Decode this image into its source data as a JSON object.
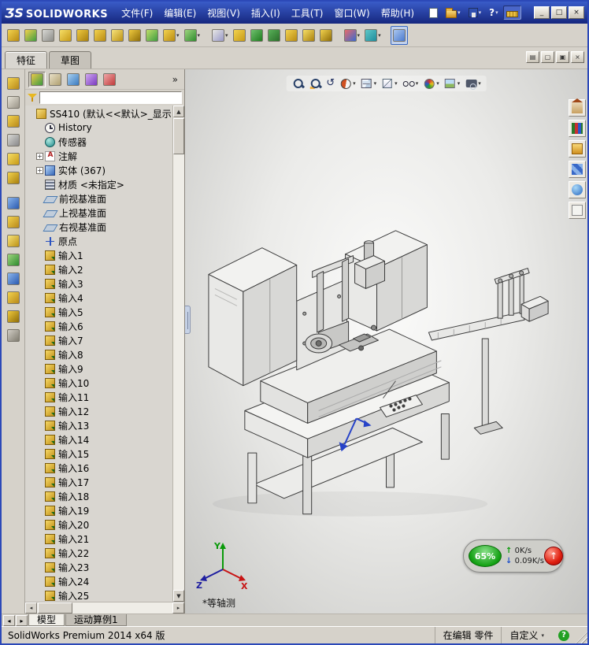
{
  "titlebar": {
    "logo_mark": "ƷS",
    "logo_text": "SOLIDWORKS",
    "menus": [
      "文件(F)",
      "编辑(E)",
      "视图(V)",
      "插入(I)",
      "工具(T)",
      "窗口(W)",
      "帮助(H)"
    ],
    "quick_icons": [
      {
        "name": "new-document-icon",
        "cls": "ic-page"
      },
      {
        "name": "open-document-icon",
        "cls": "ic-folder",
        "dd": true
      },
      {
        "name": "save-icon",
        "cls": "ic-disk",
        "dd": true
      },
      {
        "name": "help-icon",
        "glyph": "?",
        "dd": true
      },
      {
        "name": "measure-tool-icon",
        "cls": "ic-meas",
        "pressed": true
      }
    ],
    "window_buttons": [
      {
        "name": "minimize-button",
        "glyph": "_"
      },
      {
        "name": "maximize-button",
        "glyph": "□"
      },
      {
        "name": "close-button",
        "glyph": "×"
      }
    ]
  },
  "toolbar": {
    "icons": [
      {
        "name": "screen-capture-icon",
        "c1": "#f2d24e",
        "c2": "#b98b12"
      },
      {
        "name": "move-tool-icon",
        "c1": "#f2d24e",
        "c2": "#3f9c3f"
      },
      {
        "name": "selection-tool-icon",
        "c1": "#d8d8d4",
        "c2": "#8c8c88"
      },
      {
        "name": "alarm-tool-icon",
        "c1": "#f6de66",
        "c2": "#c79a16"
      },
      {
        "name": "sheet-tool-icon",
        "c1": "#eec83e",
        "c2": "#a87f0e"
      },
      {
        "name": "box-tool-icon",
        "c1": "#f2d24e",
        "c2": "#b98b12"
      },
      {
        "name": "folder-tool-icon",
        "c1": "#f6e27a",
        "c2": "#bd9214"
      },
      {
        "name": "export-tool-icon",
        "c1": "#eec83e",
        "c2": "#8f6d08"
      },
      {
        "name": "table-tool-icon",
        "c1": "#bede6a",
        "c2": "#3f9c3f"
      },
      {
        "name": "list-tool-icon",
        "c1": "#f2d24e",
        "c2": "#b98b12",
        "dd": true
      },
      {
        "name": "bom-tool-icon",
        "c1": "#9ed47e",
        "c2": "#2e8c2e",
        "dd": true
      },
      {
        "name": "pattern-tool-icon",
        "c1": "#e8e8e4",
        "c2": "#9898c8",
        "dd": true,
        "gap": true
      },
      {
        "name": "arrow-tool-icon",
        "c1": "#f2d24e",
        "c2": "#c79a16"
      },
      {
        "name": "flag-tool-icon",
        "c1": "#6ec06e",
        "c2": "#1e7c1e"
      },
      {
        "name": "library-tool-icon",
        "c1": "#58b058",
        "c2": "#2a6e2a"
      },
      {
        "name": "cylinder-tool-icon",
        "c1": "#f2d24e",
        "c2": "#b98b12"
      },
      {
        "name": "database-tool-icon",
        "c1": "#f6de66",
        "c2": "#a87f0e"
      },
      {
        "name": "history-tool-icon",
        "c1": "#f2d24e",
        "c2": "#8f6d08"
      },
      {
        "name": "render-tool-icon",
        "c1": "#e86a6a",
        "c2": "#3a6ad0",
        "dd": true,
        "gap": true
      },
      {
        "name": "rotate-tool-icon",
        "c1": "#5ec8c8",
        "c2": "#1e8c9c",
        "dd": true
      },
      {
        "name": "scale-tool-icon",
        "c1": "#aac6ee",
        "c2": "#4a7ad0",
        "pressed": true,
        "gap": true
      }
    ]
  },
  "commandmanager": {
    "tabs": [
      {
        "label": "特征",
        "active": true
      },
      {
        "label": "草图",
        "active": false
      }
    ]
  },
  "doc_controls": [
    {
      "name": "tile-windows-icon",
      "glyph": "▤"
    },
    {
      "name": "minimize-doc-icon",
      "glyph": "▢"
    },
    {
      "name": "restore-doc-icon",
      "glyph": "▣"
    },
    {
      "name": "close-doc-icon",
      "glyph": "×"
    }
  ],
  "side_toolbar": {
    "icons": [
      {
        "name": "sketch-tool-icon",
        "c1": "#f2d24e",
        "c2": "#b8891a"
      },
      {
        "name": "evaluate-tool-icon",
        "c1": "#e6e2d6",
        "c2": "#9a9488"
      },
      {
        "name": "sheet-format-icon",
        "c1": "#f2d24e",
        "c2": "#b8891a"
      },
      {
        "name": "table-tool-icon",
        "c1": "#d8d8d4",
        "c2": "#88888a"
      },
      {
        "name": "annotation-tool-icon",
        "c1": "#f6de66",
        "c2": "#c79a16"
      },
      {
        "name": "dimension-tool-icon",
        "c1": "#f2d24e",
        "c2": "#a87f0e"
      },
      {
        "name": "view-layout-icon",
        "c1": "#8ab4ec",
        "c2": "#2a5ab0",
        "gap": true
      },
      {
        "name": "blocks-tool-icon",
        "c1": "#f2d24e",
        "c2": "#b8891a"
      },
      {
        "name": "spline-tool-icon",
        "c1": "#f6e27a",
        "c2": "#bd9214"
      },
      {
        "name": "surface-tool-icon",
        "c1": "#9ed47e",
        "c2": "#2e8c2e"
      },
      {
        "name": "weldment-tool-icon",
        "c1": "#8ab4ec",
        "c2": "#2a5ab0"
      },
      {
        "name": "mold-tool-icon",
        "c1": "#f2d24e",
        "c2": "#b8891a"
      },
      {
        "name": "datum-tool-icon",
        "c1": "#eec83e",
        "c2": "#8f6d08"
      },
      {
        "name": "analysis-tool-icon",
        "c1": "#d0ccc4",
        "c2": "#807c70"
      }
    ]
  },
  "featuremanager": {
    "tab_icons": [
      {
        "name": "featuremanager-tree-icon",
        "c1": "#e8c84a",
        "c2": "#3f9c3f",
        "pressed": true
      },
      {
        "name": "propertymanager-icon",
        "c1": "#e8e0c8",
        "c2": "#b0a070"
      },
      {
        "name": "configurationmanager-icon",
        "c1": "#a8d0f0",
        "c2": "#3a7ac0"
      },
      {
        "name": "dimxpertmanager-icon",
        "c1": "#d0a8f0",
        "c2": "#7a3ac0"
      },
      {
        "name": "displaymanager-icon",
        "c1": "#f0a8a8",
        "c2": "#c03a3a"
      }
    ],
    "overflow": "»",
    "filter_value": "",
    "root": {
      "label": "SS410 (默认<<默认>_显示...",
      "icon": "part"
    },
    "items": [
      {
        "label": "History",
        "icon": "history"
      },
      {
        "label": "传感器",
        "icon": "sensors"
      },
      {
        "label": "注解",
        "icon": "annotations",
        "expand": true
      },
      {
        "label": "实体 (367)",
        "icon": "bodies",
        "expand": true
      },
      {
        "label": "材质 <未指定>",
        "icon": "material"
      },
      {
        "label": "前视基准面",
        "icon": "plane"
      },
      {
        "label": "上视基准面",
        "icon": "plane"
      },
      {
        "label": "右视基准面",
        "icon": "plane"
      },
      {
        "label": "原点",
        "icon": "origin"
      }
    ],
    "inputs": [
      "输入1",
      "输入2",
      "输入3",
      "输入4",
      "输入5",
      "输入6",
      "输入7",
      "输入8",
      "输入9",
      "输入10",
      "输入11",
      "输入12",
      "输入13",
      "输入14",
      "输入15",
      "输入16",
      "输入17",
      "输入18",
      "输入19",
      "输入20",
      "输入21",
      "输入22",
      "输入23",
      "输入24",
      "输入25"
    ]
  },
  "headsup": {
    "icons": [
      {
        "name": "zoom-fit-icon",
        "cls": "hi-mag"
      },
      {
        "name": "zoom-area-icon",
        "cls": "hi-magarea"
      },
      {
        "name": "previous-view-icon",
        "glyph": "↺"
      },
      {
        "name": "section-view-icon",
        "cls": "hi-section",
        "dd": true
      },
      {
        "name": "view-orientation-icon",
        "cls": "hi-cube",
        "dd": true
      },
      {
        "name": "display-style-icon",
        "cls": "hi-style",
        "dd": true
      },
      {
        "name": "hide-show-icon",
        "cls": "hi-eye",
        "dd": true
      },
      {
        "name": "edit-appearance-icon",
        "cls": "hi-ball",
        "dd": true
      },
      {
        "name": "apply-scene-icon",
        "cls": "hi-scene",
        "dd": true
      },
      {
        "name": "view-settings-icon",
        "cls": "hi-cam",
        "dd": true
      }
    ]
  },
  "taskpane": {
    "icons": [
      {
        "name": "solidworks-resources-icon",
        "cls": "tp-home"
      },
      {
        "name": "design-library-icon",
        "cls": "tp-lib"
      },
      {
        "name": "file-explorer-icon",
        "cls": "tp-folder"
      },
      {
        "name": "view-palette-icon",
        "cls": "tp-palette"
      },
      {
        "name": "appearances-icon",
        "cls": "tp-ball"
      },
      {
        "name": "custom-properties-icon",
        "cls": "tp-props"
      }
    ]
  },
  "viewport": {
    "view_label": "*等轴测",
    "axis_x": "X",
    "axis_y": "Y",
    "axis_z": "Z"
  },
  "download_widget": {
    "percent": "65%",
    "up_speed": "0K/s",
    "down_speed": "0.09K/s",
    "boost_glyph": "↑"
  },
  "doc_tabs": {
    "nav": [
      {
        "name": "tab-scroll-left-button",
        "glyph": "◂"
      },
      {
        "name": "tab-scroll-right-button",
        "glyph": "▸"
      }
    ],
    "tabs": [
      {
        "label": "模型",
        "active": true
      },
      {
        "label": "运动算例1",
        "active": false
      }
    ]
  },
  "statusbar": {
    "app_version": "SolidWorks Premium 2014 x64 版",
    "editing": "在编辑 零件",
    "custom_label": "自定义",
    "help_glyph": "?"
  }
}
